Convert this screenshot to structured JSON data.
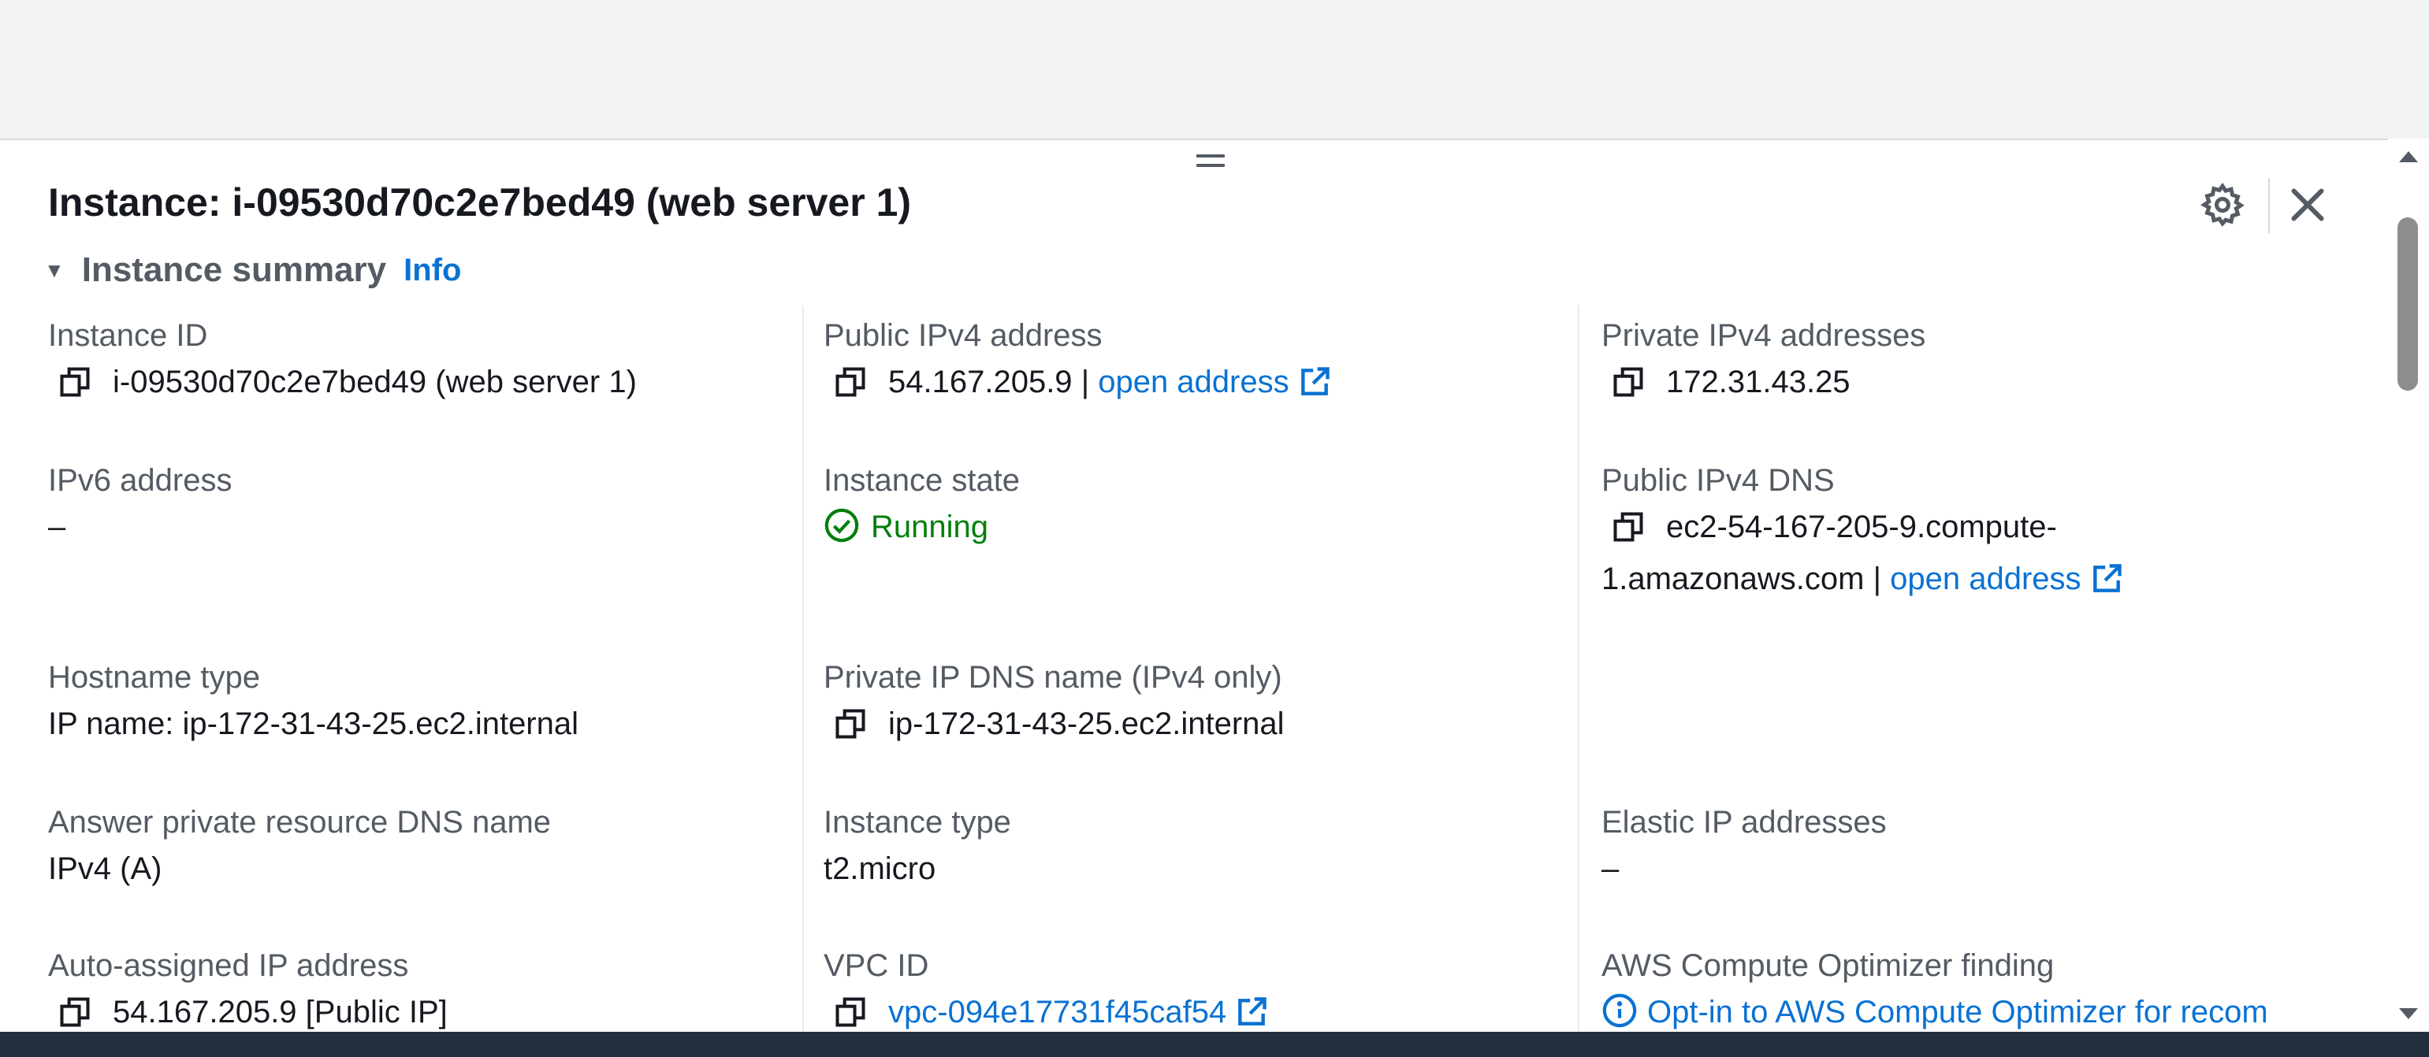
{
  "panel": {
    "title": "Instance: i-09530d70c2e7bed49 (web server 1)",
    "section_title": "Instance summary",
    "section_info": "Info"
  },
  "fields": {
    "instance_id": {
      "label": "Instance ID",
      "value": "i-09530d70c2e7bed49 (web server 1)"
    },
    "public_ipv4": {
      "label": "Public IPv4 address",
      "value": "54.167.205.9",
      "separator": "|",
      "link": "open address"
    },
    "private_ipv4": {
      "label": "Private IPv4 addresses",
      "value": "172.31.43.25"
    },
    "ipv6": {
      "label": "IPv6 address",
      "value": "–"
    },
    "instance_state": {
      "label": "Instance state",
      "value": "Running"
    },
    "public_dns": {
      "label": "Public IPv4 DNS",
      "value": "ec2-54-167-205-9.compute-1.amazonaws.com",
      "separator": "|",
      "link": "open address"
    },
    "hostname_type": {
      "label": "Hostname type",
      "value": "IP name: ip-172-31-43-25.ec2.internal"
    },
    "private_dns": {
      "label": "Private IP DNS name (IPv4 only)",
      "value": "ip-172-31-43-25.ec2.internal"
    },
    "answer_dns": {
      "label": "Answer private resource DNS name",
      "value": "IPv4 (A)"
    },
    "instance_type": {
      "label": "Instance type",
      "value": "t2.micro"
    },
    "elastic_ip": {
      "label": "Elastic IP addresses",
      "value": "–"
    },
    "auto_ip": {
      "label": "Auto-assigned IP address",
      "value": "54.167.205.9 [Public IP]"
    },
    "vpc_id": {
      "label": "VPC ID",
      "value": "vpc-094e17731f45caf54"
    },
    "optimizer": {
      "label": "AWS Compute Optimizer finding",
      "value": "Opt-in to AWS Compute Optimizer for recom"
    }
  },
  "colors": {
    "link": "#0972d3",
    "running": "#037f0c",
    "label": "#545b64",
    "text": "#16191f",
    "footer": "#232f3e"
  },
  "icons": [
    "copy-icon",
    "external-link-icon",
    "check-circle-icon",
    "info-icon",
    "settings-icon",
    "close-icon"
  ]
}
